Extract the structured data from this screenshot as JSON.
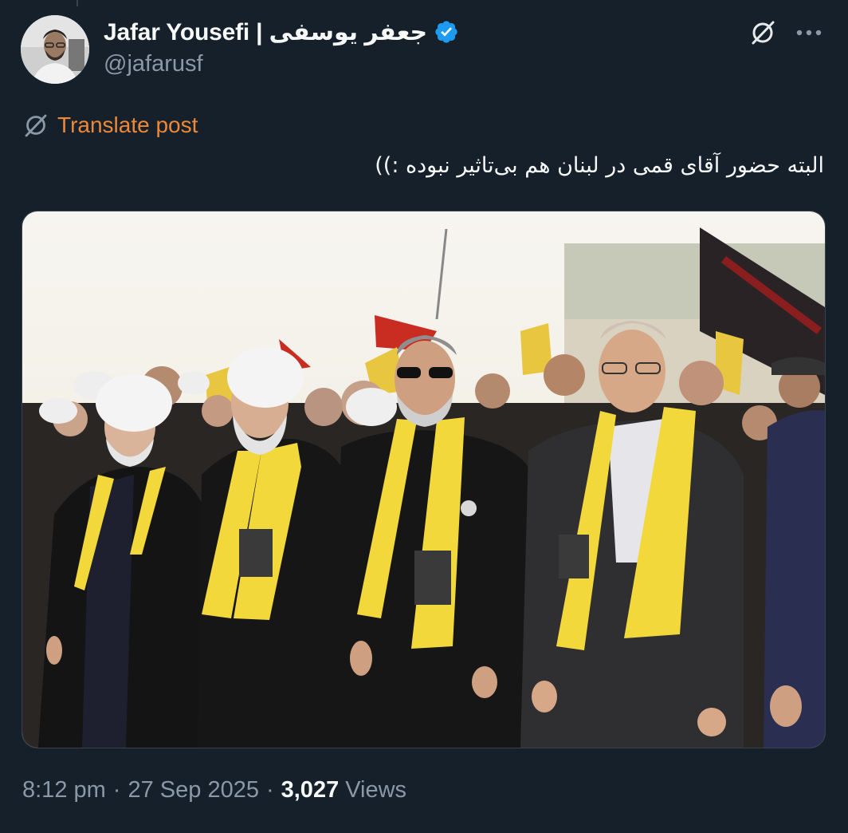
{
  "author": {
    "display_name": "Jafar Yousefi | جعفر یوسفی",
    "handle": "@jafarusf",
    "verified": true,
    "verified_color": "#1d9bf0"
  },
  "translate": {
    "label": "Translate post",
    "color": "#ec8837"
  },
  "tweet": {
    "text": "البته حضور آقای قمی در لبنان هم بی‌تاثیر نبوده :))"
  },
  "meta": {
    "time": "8:12 pm",
    "date": "27 Sep 2025",
    "views_count": "3,027",
    "views_label": "Views"
  },
  "icons": {
    "grok": "grok-icon",
    "more": "more-icon",
    "translate": "translate-icon",
    "verified": "verified-badge-icon"
  },
  "colors": {
    "background": "#15202b",
    "text": "#f7f9f9",
    "secondary": "#8b98a5",
    "scarf_yellow": "#f2d83a"
  }
}
